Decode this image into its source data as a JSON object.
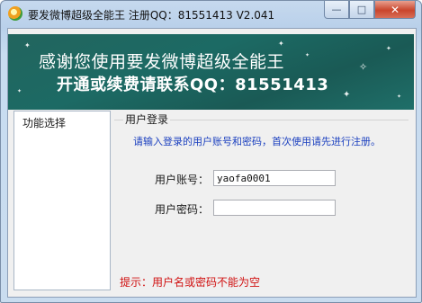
{
  "window": {
    "title": "要发微博超级全能王 注册QQ：81551413 V2.041",
    "controls": {
      "minimize": "—",
      "maximize": "□",
      "close": "✕"
    }
  },
  "banner": {
    "line1": "感谢您使用要发微博超级全能王",
    "line2": "开通或续费请联系QQ：81551413"
  },
  "sidebar": {
    "title": "功能选择"
  },
  "login": {
    "group_title": "用户登录",
    "hint": "请输入登录的用户账号和密码，首次使用请先进行注册。",
    "account_label": "用户账号：",
    "account_value": "yaofa0001",
    "password_label": "用户密码：",
    "password_value": "",
    "error": "提示：用户名或密码不能为空"
  },
  "colors": {
    "banner_bg": "#1c6a64",
    "hint": "#1a3fbf",
    "error": "#d01010",
    "close_button": "#c9452c"
  }
}
